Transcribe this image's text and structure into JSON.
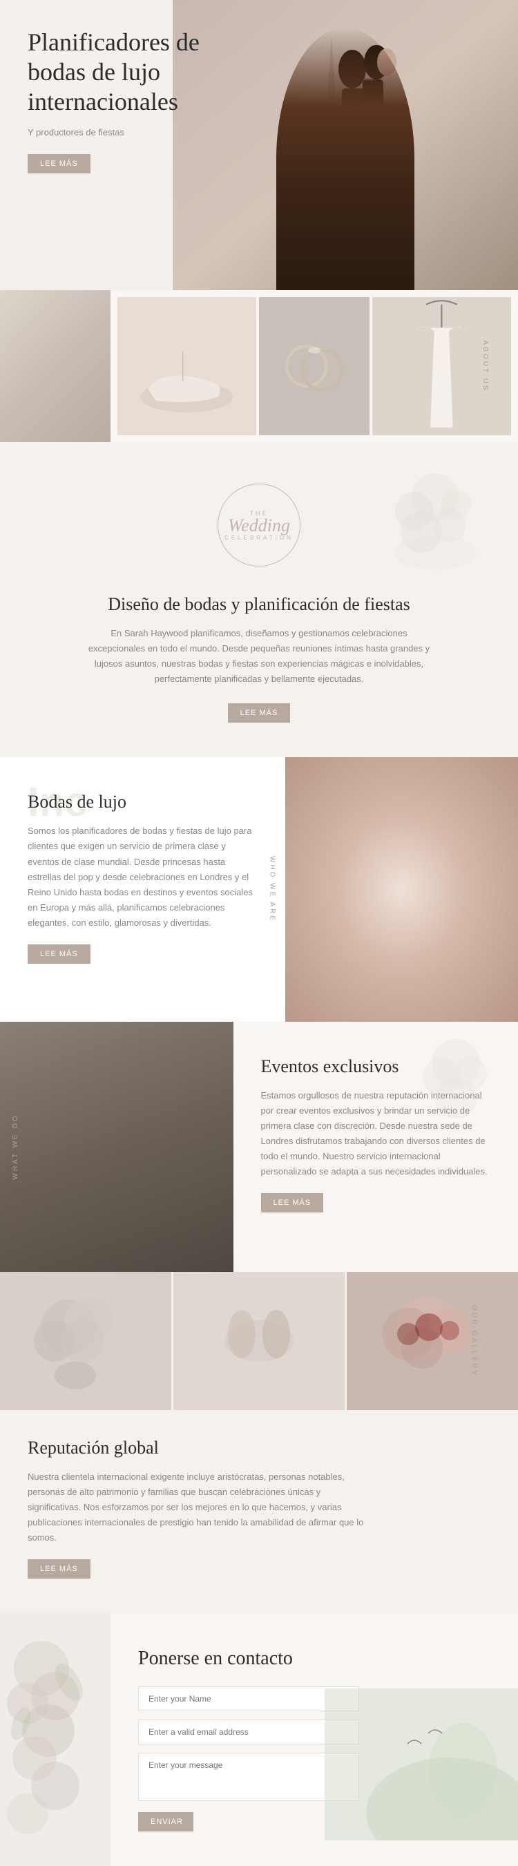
{
  "hero": {
    "title": "Planificadores de bodas de lujo internacionales",
    "subtitle": "Y productores de fiestas",
    "cta_label": "Lee más"
  },
  "about": {
    "label_vert": "ABOUT US"
  },
  "wedding": {
    "the": "THE",
    "script": "Wedding",
    "celebration": "CELEBRATION",
    "title": "Diseño de bodas y planificación de fiestas",
    "text": "En Sarah Haywood planificamos, diseñamos y gestionamos celebraciones excepcionales en todo el mundo. Desde pequeñas reuniones íntimas hasta grandes y lujosos asuntos, nuestras bodas y fiestas son experiencias mágicas e inolvidables, perfectamente planificadas y bellamente ejecutadas.",
    "cta_label": "Lee más"
  },
  "luxury": {
    "bg_text": "Inc",
    "title": "Bodas de lujo",
    "text": "Somos los planificadores de bodas y fiestas de lujo para clientes que exigen un servicio de primera clase y eventos de clase mundial. Desde princesas hasta estrellas del pop y desde celebraciones en Londres y el Reino Unido hasta bodas en destinos y eventos sociales en Europa y más allá, planificamos celebraciones elegantes, con estilo, glamorosas y divertidas.",
    "cta_label": "Lee más",
    "label_vert": "WHO WE ARE"
  },
  "whatwedo": {
    "title": "Eventos exclusivos",
    "text": "Estamos orgullosos de nuestra reputación internacional por crear eventos exclusivos y brindar un servicio de primera clase con discreción. Desde nuestra sede de Londres disfrutamos trabajando con diversos clientes de todo el mundo. Nuestro servicio internacional personalizado se adapta a sus necesidades individuales.",
    "cta_label": "Lee más",
    "label_vert": "WHAT WE DO"
  },
  "gallery": {
    "label_vert": "OUR GALLERY",
    "title": "Reputación global",
    "text": "Nuestra clientela internacional exigente incluye aristócratas, personas notables, personas de alto patrimonio y familias que buscan celebraciones únicas y significativas. Nos esforzamos por ser los mejores en lo que hacemos, y varias publicaciones internacionales de prestigio han tenido la amabilidad de afirmar que lo somos.",
    "cta_label": "Lee más"
  },
  "contact": {
    "title": "Ponerse en contacto",
    "name_placeholder": "Enter your Name",
    "email_placeholder": "Enter a valid email address",
    "message_placeholder": "Enter your message",
    "submit_label": "Enviar"
  }
}
